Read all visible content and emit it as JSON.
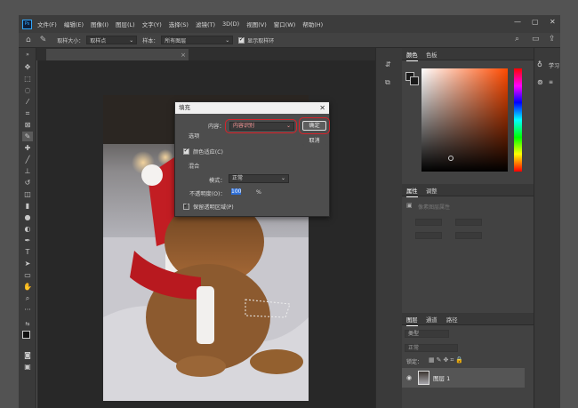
{
  "app": {
    "logo_text": "Ps"
  },
  "menu": [
    "文件(F)",
    "编辑(E)",
    "图像(I)",
    "图层(L)",
    "文字(Y)",
    "选择(S)",
    "滤镜(T)",
    "3D(D)",
    "视图(V)",
    "窗口(W)",
    "帮助(H)"
  ],
  "window_controls": {
    "minimize": "—",
    "restore": "▢",
    "close": "✕"
  },
  "options_bar": {
    "sample_size_label": "取样大小：",
    "sample_size_value": "取样点",
    "sample_label": "样本：",
    "sample_value": "所有图层",
    "show_ring_label": "显示取样环"
  },
  "document_tab": {
    "close": "×"
  },
  "dialog": {
    "title": "填充",
    "close": "✕",
    "content_label": "内容：",
    "content_value": "内容识别",
    "options_label": "选项",
    "color_adapt_label": "颜色适应(C)",
    "blend_label": "混合",
    "mode_label": "模式：",
    "mode_value": "正常",
    "opacity_label": "不透明度(O)：",
    "opacity_value": "100",
    "opacity_unit": "%",
    "preserve_label": "保留透明区域(P)",
    "ok_label": "确定",
    "cancel_label": "取消"
  },
  "panels": {
    "color_tab": "颜色",
    "swatches_tab": "色板",
    "properties_tab": "属性",
    "adjust_tab": "调整",
    "properties_hint": "像素图层属性",
    "layers_tab": "图层",
    "channels_tab": "通道",
    "paths_tab": "路径",
    "layer_kind": "类型",
    "blend_mode": "正常",
    "lock_label": "锁定：",
    "layer_name": "图层 1"
  },
  "right_panel": {
    "learn_label": "学习"
  },
  "colors": {
    "highlight": "#d8222a",
    "accent": "#31a8ff"
  }
}
